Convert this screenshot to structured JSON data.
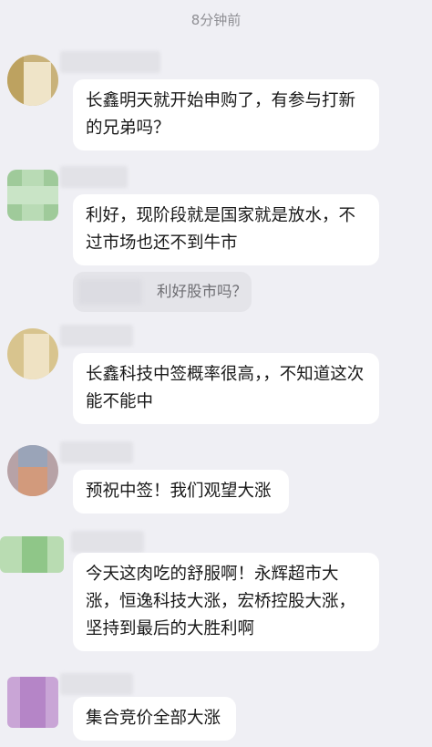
{
  "timestamp": "8分钟前",
  "messages": [
    {
      "text": "长鑫明天就开始申购了，有参与打新的兄弟吗？"
    },
    {
      "text": "利好，现阶段就是国家就是放水，不过市场也还不到牛市"
    },
    {
      "text": "长鑫科技中签概率很高，，不知道这次能不能中"
    },
    {
      "text": "预祝中签！我们观望大涨"
    },
    {
      "text": "今天这肉吃的舒服啊！永辉超市大涨，恒逸科技大涨，宏桥控股大涨，坚持到最后的大胜利啊"
    },
    {
      "text": "集合竞价全部大涨"
    }
  ],
  "quote": {
    "text": "利好股市吗？"
  },
  "colors": {
    "background": "#efeff4",
    "bubble": "#ffffff",
    "quote_bg": "#e4e4e9",
    "time": "#8f8f94"
  }
}
